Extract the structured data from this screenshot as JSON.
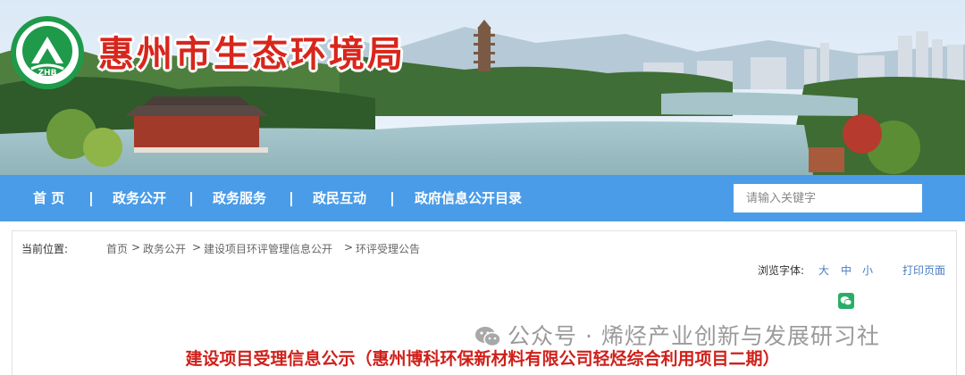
{
  "header": {
    "site_title": "惠州市生态环境局",
    "logo_text": "ZHB"
  },
  "nav": {
    "items": [
      {
        "label": "首  页"
      },
      {
        "label": "政务公开"
      },
      {
        "label": "政务服务"
      },
      {
        "label": "政民互动"
      },
      {
        "label": "政府信息公开目录"
      }
    ],
    "separator": "|",
    "search_placeholder": "请输入关键字"
  },
  "breadcrumb": {
    "label": "当前位置:",
    "items": [
      "首页",
      "政务公开",
      "建设项目环评管理信息公开",
      "环评受理公告"
    ],
    "separator": ">"
  },
  "tools": {
    "font_label": "浏览字体:",
    "sizes": [
      "大",
      "中",
      "小"
    ],
    "print": "打印页面"
  },
  "watermark": {
    "text": "公众号 · 烯烃产业创新与发展研习社"
  },
  "article": {
    "title": "建设项目受理信息公示（惠州博科环保新材料有限公司轻烃综合利用项目二期）"
  },
  "colors": {
    "nav_bg": "#4a9ce8",
    "title_red": "#d0201a",
    "site_title_red": "#d8261c",
    "link_blue": "#4a7cc2",
    "logo_green": "#1e9a4a"
  }
}
